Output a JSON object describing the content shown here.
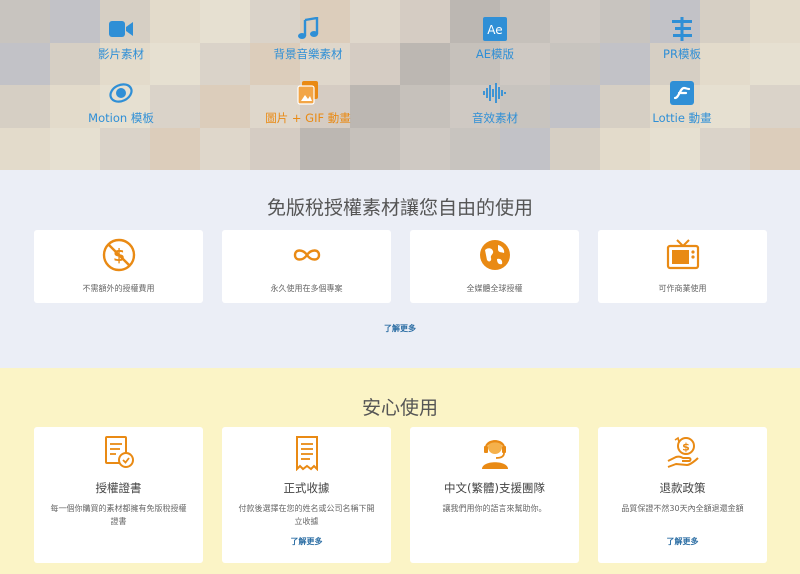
{
  "categories": [
    {
      "label": "影片素材",
      "icon": "video-camera-icon",
      "color": "#2f8fd6"
    },
    {
      "label": "背景音樂素材",
      "icon": "music-note-icon",
      "color": "#2f8fd6"
    },
    {
      "label": "AE模版",
      "icon": "ae-logo-icon",
      "color": "#2f8fd6"
    },
    {
      "label": "PR模板",
      "icon": "pr-sliders-icon",
      "color": "#2f8fd6"
    },
    {
      "label": "Motion 模板",
      "icon": "motion-logo-icon",
      "color": "#2f8fd6"
    },
    {
      "label": "圖片 + GIF 動畫",
      "icon": "image-gif-icon",
      "color": "#e98a14"
    },
    {
      "label": "音效素材",
      "icon": "sound-wave-icon",
      "color": "#2f8fd6"
    },
    {
      "label": "Lottie 動畫",
      "icon": "lottie-logo-icon",
      "color": "#2f8fd6"
    }
  ],
  "royalty_free": {
    "title": "免版稅授權素材讓您自由的使用",
    "cards": [
      {
        "text": "不需額外的授權費用",
        "icon": "no-fee-icon"
      },
      {
        "text": "永久使用在多個專案",
        "icon": "infinity-icon"
      },
      {
        "text": "全媒體全球授權",
        "icon": "globe-icon"
      },
      {
        "text": "可作商業使用",
        "icon": "tv-icon"
      }
    ],
    "learn_more": "了解更多"
  },
  "peace_of_mind": {
    "title": "安心使用",
    "cards": [
      {
        "heading": "授權證書",
        "desc": "每一個你購買的素材都擁有免版稅授權證書",
        "more": "",
        "icon": "certificate-icon"
      },
      {
        "heading": "正式收據",
        "desc": "付款後選擇在您的姓名或公司名稱下開立收據",
        "more": "了解更多",
        "icon": "receipt-icon"
      },
      {
        "heading": "中文(繁體)支援團隊",
        "desc": "讓我們用你的語言來幫助你。",
        "more": "",
        "icon": "support-agent-icon"
      },
      {
        "heading": "退款政策",
        "desc": "品質保證不然30天內全額退還金額",
        "more": "了解更多",
        "icon": "refund-hand-icon"
      }
    ]
  },
  "colors": {
    "blue": "#2f8fd6",
    "orange": "#e98a14",
    "yellow_bg": "#fbf4c6",
    "grey_bg": "#ebeef6"
  }
}
